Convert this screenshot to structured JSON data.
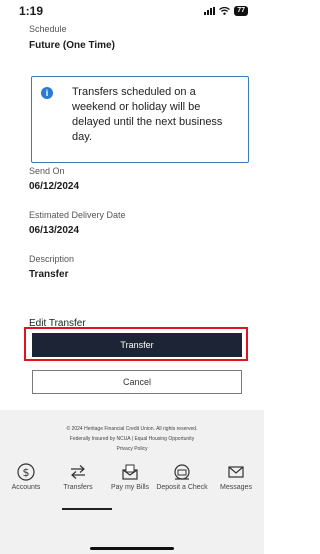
{
  "status": {
    "time": "1:19",
    "battery": "77"
  },
  "schedule": {
    "label": "Schedule",
    "value": "Future (One Time)",
    "info": "Transfers scheduled on a weekend or holiday will be delayed until the next business day."
  },
  "details": {
    "send_on_label": "Send On",
    "send_on_value": "06/12/2024",
    "delivery_label": "Estimated Delivery Date",
    "delivery_value": "06/13/2024",
    "description_label": "Description",
    "description_value": "Transfer"
  },
  "actions": {
    "edit_label": "Edit Transfer",
    "transfer_label": "Transfer",
    "cancel_label": "Cancel"
  },
  "footer": {
    "copyright": "© 2024 Heritage Financial Credit Union. All rights reserved.",
    "insured": "Federally Insured by NCUA | Equal Housing Opportunity",
    "privacy": "Privacy Policy"
  },
  "tabs": [
    {
      "label": "Accounts",
      "icon": "dollar-circle-icon"
    },
    {
      "label": "Transfers",
      "icon": "transfer-arrows-icon"
    },
    {
      "label": "Pay my Bills",
      "icon": "bill-envelope-icon"
    },
    {
      "label": "Deposit a Check",
      "icon": "deposit-check-icon"
    },
    {
      "label": "Messages",
      "icon": "mail-icon"
    }
  ],
  "colors": {
    "primary_button": "#1c2436",
    "highlight": "#e0141e",
    "info_accent": "#2a7bd1"
  }
}
